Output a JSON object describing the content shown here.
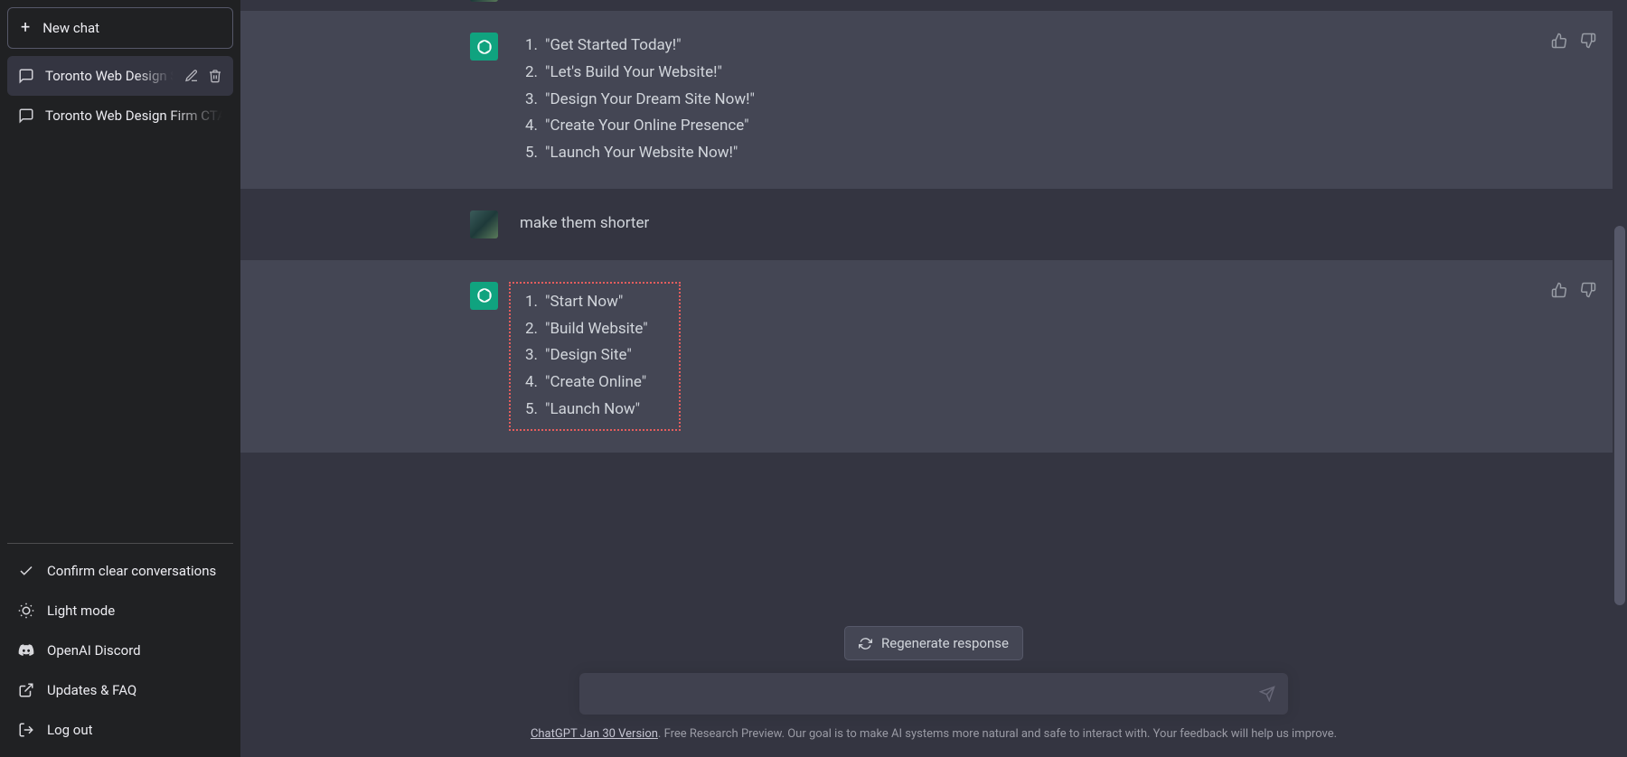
{
  "sidebar": {
    "new_chat_label": "New chat",
    "chats": [
      {
        "title": "Toronto Web Design Sl",
        "active": true
      },
      {
        "title": "Toronto Web Design Firm CTA",
        "active": false
      }
    ],
    "footer": {
      "confirm_clear": "Confirm clear conversations",
      "light_mode": "Light mode",
      "discord": "OpenAI Discord",
      "updates_faq": "Updates & FAQ",
      "logout": "Log out"
    }
  },
  "conversation": {
    "assistant1": {
      "items": [
        "\"Get Started Today!\"",
        "\"Let's Build Your Website!\"",
        "\"Design Your Dream Site Now!\"",
        "\"Create Your Online Presence\"",
        "\"Launch Your Website Now!\""
      ]
    },
    "user2": {
      "text": "make them shorter"
    },
    "assistant2": {
      "items": [
        "\"Start Now\"",
        "\"Build Website\"",
        "\"Design Site\"",
        "\"Create Online\"",
        "\"Launch Now\""
      ]
    }
  },
  "controls": {
    "regenerate_label": "Regenerate response",
    "input_placeholder": ""
  },
  "disclaimer": {
    "link_text": "ChatGPT Jan 30 Version",
    "rest": ". Free Research Preview. Our goal is to make AI systems more natural and safe to interact with. Your feedback will help us improve."
  }
}
